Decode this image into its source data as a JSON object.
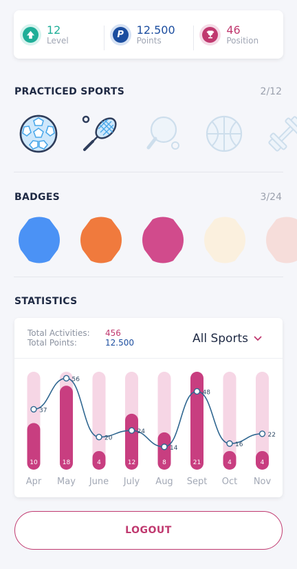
{
  "stats": [
    {
      "value": "12",
      "label": "Level",
      "icon": "level-up-icon",
      "color": "#1fae98"
    },
    {
      "value": "12.500",
      "label": "Points",
      "icon": "points-icon",
      "color": "#1b4d9f"
    },
    {
      "value": "46",
      "label": "Position",
      "icon": "trophy-icon",
      "color": "#c0396f"
    }
  ],
  "practiced_sports": {
    "title": "PRACTICED SPORTS",
    "count": "2/12",
    "items": [
      {
        "name": "soccer-ball-icon",
        "active": true
      },
      {
        "name": "tennis-racket-icon",
        "active": true
      },
      {
        "name": "ping-pong-icon",
        "active": false
      },
      {
        "name": "basketball-icon",
        "active": false
      },
      {
        "name": "dumbbell-icon",
        "active": false
      }
    ]
  },
  "badges": {
    "title": "BADGES",
    "count": "3/24",
    "items": [
      {
        "color": "#4b92f5"
      },
      {
        "color": "#f07a3d"
      },
      {
        "color": "#d14b8c"
      },
      {
        "color": "#fbf0de"
      },
      {
        "color": "#f6ddda"
      }
    ]
  },
  "statistics": {
    "title": "STATISTICS",
    "total_activities_label": "Total Activities:",
    "total_activities_value": "456",
    "total_points_label": "Total Points:",
    "total_points_value": "12.500",
    "selected_sport": "All Sports"
  },
  "chart_data": {
    "type": "bar",
    "categories": [
      "Apr",
      "May",
      "June",
      "July",
      "Aug",
      "Sept",
      "Oct",
      "Nov"
    ],
    "series": [
      {
        "values": [
          10,
          18,
          4,
          12,
          8,
          21,
          4,
          4
        ]
      },
      {
        "type": "line",
        "values": [
          37,
          56,
          20,
          24,
          14,
          48,
          16,
          22
        ]
      }
    ],
    "bar_max": 21,
    "line_range": [
      0,
      60
    ],
    "colors": {
      "bar": "#c83e80",
      "track": "#f6d6e5",
      "line": "#2f6690"
    }
  },
  "logout_label": "LOGOUT"
}
